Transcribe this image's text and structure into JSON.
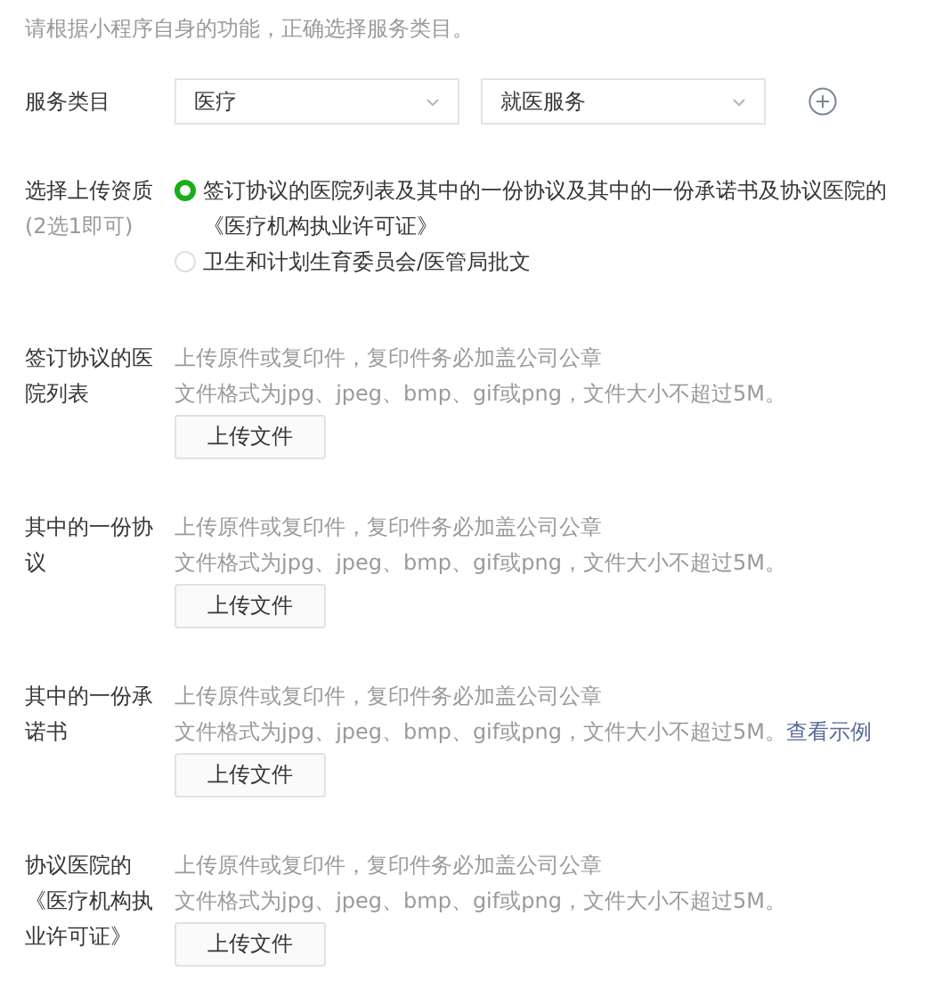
{
  "intro": "请根据小程序自身的功能，正确选择服务类目。",
  "service_category": {
    "label": "服务类目",
    "selects": [
      {
        "value": "医疗"
      },
      {
        "value": "就医服务"
      }
    ]
  },
  "qualification": {
    "label": "选择上传资质",
    "note": "(2选1即可)",
    "options": [
      {
        "label": "签订协议的医院列表及其中的一份协议及其中的一份承诺书及协议医院的《医疗机构执业许可证》",
        "selected": true
      },
      {
        "label": "卫生和计划生育委员会/医管局批文",
        "selected": false
      }
    ]
  },
  "uploads": [
    {
      "label": "签订协议的医院列表",
      "hint": "上传原件或复印件，复印件务必加盖公司公章",
      "format": "文件格式为jpg、jpeg、bmp、gif或png，文件大小不超过5M。",
      "button": "上传文件"
    },
    {
      "label": "其中的一份协议",
      "hint": "上传原件或复印件，复印件务必加盖公司公章",
      "format": "文件格式为jpg、jpeg、bmp、gif或png，文件大小不超过5M。",
      "button": "上传文件"
    },
    {
      "label": "其中的一份承诺书",
      "hint": "上传原件或复印件，复印件务必加盖公司公章",
      "format": "文件格式为jpg、jpeg、bmp、gif或png，文件大小不超过5M。",
      "link": "查看示例",
      "button": "上传文件"
    },
    {
      "label": "协议医院的《医疗机构执业许可证》",
      "hint": "上传原件或复印件，复印件务必加盖公司公章",
      "format": "文件格式为jpg、jpeg、bmp、gif或png，文件大小不超过5M。",
      "button": "上传文件"
    }
  ]
}
